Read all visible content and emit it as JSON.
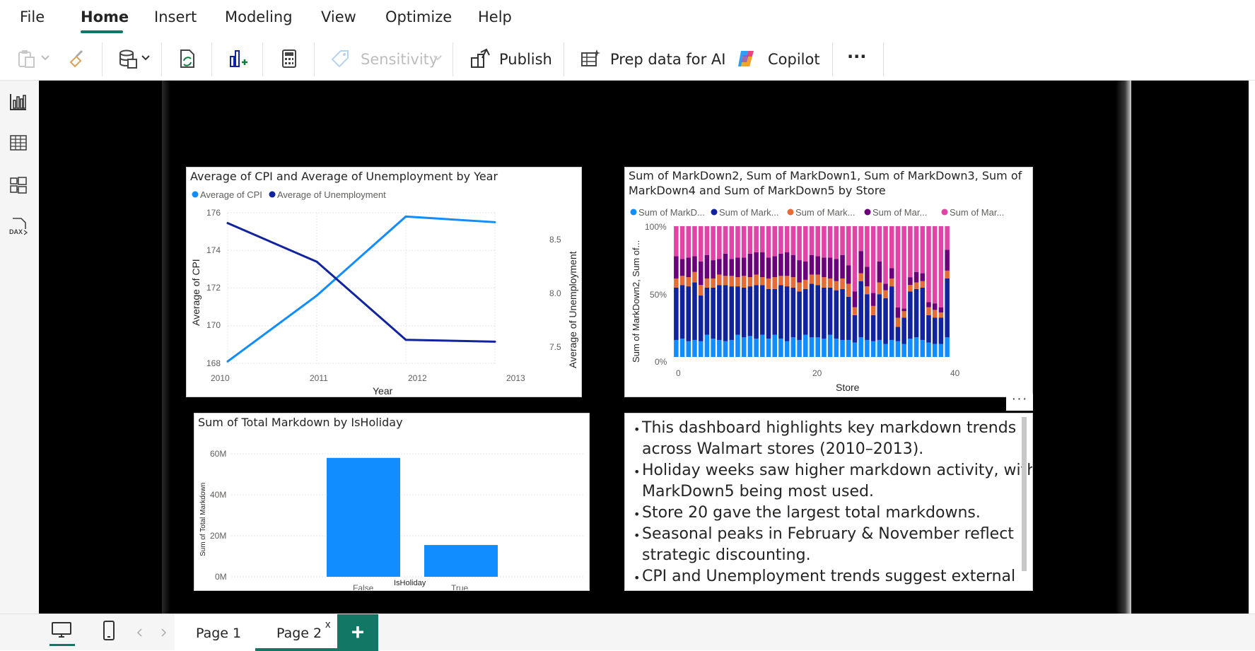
{
  "menu": {
    "items": [
      {
        "label": "File"
      },
      {
        "label": "Home"
      },
      {
        "label": "Insert"
      },
      {
        "label": "Modeling"
      },
      {
        "label": "View"
      },
      {
        "label": "Optimize"
      },
      {
        "label": "Help"
      }
    ],
    "active": "Home"
  },
  "ribbon": {
    "sensitivity_label": "Sensitivity",
    "publish_label": "Publish",
    "prep_label": "Prep data for AI",
    "copilot_label": "Copilot",
    "more_label": "···"
  },
  "colors": {
    "accent": "#117865",
    "series_blue_light": "#118DFF",
    "series_blue_dark": "#12239E",
    "series_orange": "#E66C37",
    "series_purple": "#6B007B",
    "series_pink": "#E044A7"
  },
  "chart_data": [
    {
      "type": "line",
      "title": "Average of CPI and Average of Unemployment by Year",
      "legend": [
        "Average of CPI",
        "Average of Unemployment"
      ],
      "legend_position": "top-left",
      "xlabel": "Year",
      "ylabel": "Average of CPI",
      "y2label": "Average of Unemployment",
      "x": [
        "2010",
        "2011",
        "2012",
        "2013"
      ],
      "series": [
        {
          "name": "Average of CPI",
          "axis": "left",
          "values": [
            168.1,
            171.6,
            175.8,
            175.5
          ],
          "color": "#118DFF"
        },
        {
          "name": "Average of Unemployment",
          "axis": "right",
          "values": [
            8.49,
            8.08,
            7.25,
            7.23
          ],
          "color": "#12239E"
        }
      ],
      "ylim": [
        168,
        176
      ],
      "yticks": [
        "176",
        "174",
        "172",
        "170",
        "168"
      ],
      "y2ticks": [
        "8.5",
        "8.0",
        "7.5"
      ],
      "y2lim": [
        7.0,
        8.6
      ],
      "grid": true
    },
    {
      "type": "bar",
      "stacked": "100%",
      "title": "Sum of MarkDown2, Sum of MarkDown1, Sum of MarkDown3, Sum of MarkDown4 and Sum of MarkDown5 by Store",
      "title_line1": "Sum of MarkDown2, Sum of MarkDown1, Sum of MarkDown3, Sum of",
      "title_line2": "MarkDown4 and Sum of MarkDown5 by Store",
      "legend": [
        "Sum of MarkD...",
        "Sum of Mark...",
        "Sum of Mark...",
        "Sum of Mar...",
        "Sum of Mar..."
      ],
      "legend_position": "top-left",
      "xlabel": "Store",
      "ylabel": "Sum of MarkDown2, Sum of...",
      "yticks": [
        "100%",
        "50%",
        "0%"
      ],
      "xticks": [
        "0",
        "20",
        "40"
      ],
      "categories": [
        1,
        2,
        3,
        4,
        5,
        6,
        7,
        8,
        9,
        10,
        11,
        12,
        13,
        14,
        15,
        16,
        17,
        18,
        19,
        20,
        21,
        22,
        23,
        24,
        25,
        26,
        27,
        28,
        29,
        30,
        31,
        32,
        33,
        34,
        35,
        36,
        37,
        38,
        39,
        40,
        41,
        42,
        43,
        44,
        45
      ],
      "series": [
        {
          "name": "Sum of MarkDown2",
          "color": "#118DFF",
          "values": [
            0.13,
            0.14,
            0.12,
            0.13,
            0.12,
            0.17,
            0.14,
            0.13,
            0.12,
            0.13,
            0.17,
            0.15,
            0.16,
            0.14,
            0.17,
            0.14,
            0.17,
            0.14,
            0.12,
            0.15,
            0.13,
            0.17,
            0.15,
            0.15,
            0.14,
            0.17,
            0.14,
            0.13,
            0.13,
            0.11,
            0.15,
            0.13,
            0.12,
            0.13,
            0.1,
            0.13,
            0.12,
            0.1,
            0.14,
            0.15,
            0.13,
            0.11,
            0.1,
            0.1,
            0.15
          ]
        },
        {
          "name": "Sum of MarkDown1",
          "color": "#12239E",
          "values": [
            0.4,
            0.41,
            0.42,
            0.44,
            0.35,
            0.36,
            0.39,
            0.42,
            0.43,
            0.41,
            0.37,
            0.38,
            0.38,
            0.41,
            0.38,
            0.38,
            0.35,
            0.41,
            0.42,
            0.38,
            0.37,
            0.35,
            0.41,
            0.4,
            0.39,
            0.36,
            0.37,
            0.39,
            0.33,
            0.21,
            0.43,
            0.35,
            0.2,
            0.35,
            0.35,
            0.41,
            0.11,
            0.2,
            0.36,
            0.37,
            0.4,
            0.21,
            0.2,
            0.2,
            0.45
          ]
        },
        {
          "name": "Sum of MarkDown3",
          "color": "#E66C37",
          "values": [
            0.07,
            0.07,
            0.07,
            0.08,
            0.08,
            0.07,
            0.07,
            0.08,
            0.07,
            0.08,
            0.07,
            0.09,
            0.07,
            0.08,
            0.06,
            0.08,
            0.09,
            0.07,
            0.08,
            0.08,
            0.07,
            0.07,
            0.07,
            0.08,
            0.08,
            0.07,
            0.07,
            0.08,
            0.1,
            0.06,
            0.06,
            0.06,
            0.07,
            0.09,
            0.06,
            0.06,
            0.07,
            0.05,
            0.05,
            0.05,
            0.05,
            0.06,
            0.06,
            0.04,
            0.06
          ]
        },
        {
          "name": "Sum of MarkDown4",
          "color": "#6B007B",
          "values": [
            0.17,
            0.13,
            0.15,
            0.12,
            0.18,
            0.18,
            0.14,
            0.12,
            0.17,
            0.13,
            0.15,
            0.14,
            0.18,
            0.17,
            0.19,
            0.16,
            0.16,
            0.17,
            0.18,
            0.17,
            0.17,
            0.14,
            0.15,
            0.14,
            0.15,
            0.16,
            0.17,
            0.18,
            0.14,
            0.12,
            0.17,
            0.15,
            0.1,
            0.16,
            0.05,
            0.08,
            0.08,
            0.02,
            0.06,
            0.08,
            0.06,
            0.04,
            0.05,
            0.04,
            0.16
          ]
        },
        {
          "name": "Sum of MarkDown5",
          "color": "#E044A7",
          "values": [
            0.23,
            0.25,
            0.24,
            0.23,
            0.27,
            0.22,
            0.26,
            0.25,
            0.21,
            0.25,
            0.24,
            0.24,
            0.21,
            0.2,
            0.2,
            0.24,
            0.23,
            0.21,
            0.2,
            0.22,
            0.26,
            0.27,
            0.22,
            0.23,
            0.24,
            0.24,
            0.25,
            0.22,
            0.3,
            0.5,
            0.19,
            0.31,
            0.51,
            0.27,
            0.44,
            0.32,
            0.62,
            0.63,
            0.39,
            0.35,
            0.36,
            0.58,
            0.59,
            0.62,
            0.18
          ]
        }
      ],
      "ylim": [
        0,
        1
      ],
      "grid": true
    },
    {
      "type": "bar",
      "title": "Sum of Total Markdown by IsHoliday",
      "xlabel": "IsHoliday",
      "ylabel": "Sum of Total Markdown",
      "categories": [
        "False",
        "True"
      ],
      "values": [
        58000000,
        15500000
      ],
      "yticks": [
        "60M",
        "40M",
        "20M",
        "0M"
      ],
      "ylim": [
        0,
        60000000
      ],
      "color": "#118DFF",
      "grid": true
    }
  ],
  "textbox": {
    "bullets": [
      [
        "This dashboard highlights key markdown trends",
        "across Walmart stores (2010–2013)."
      ],
      [
        "Holiday weeks saw higher markdown activity, with",
        "MarkDown5 being most used."
      ],
      [
        "Store 20 gave the largest total markdowns."
      ],
      [
        "Seasonal peaks in February & November reflect",
        "strategic discounting."
      ],
      [
        "CPI and Unemployment trends suggest external"
      ]
    ]
  },
  "visual_more": "···",
  "pages": {
    "tabs": [
      {
        "label": "Page 1"
      },
      {
        "label": "Page 2"
      }
    ],
    "active": "Page 2",
    "close": "x",
    "add": "+"
  }
}
